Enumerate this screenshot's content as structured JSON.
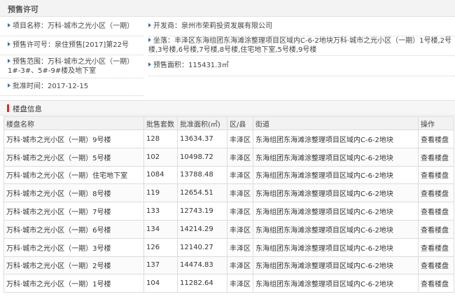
{
  "header": {
    "title": "预售许可"
  },
  "permit": {
    "project_name": "项目名称：万科·城市之光小区（一期）",
    "developer": "开发商：泉州市荣莉投资发展有限公司",
    "permit_no": "预售许可号：泉住预售[2017]第22号",
    "location": "坐落：丰泽区东海组团东海滩涂整理项目区域内C-6-2地块万科·城市之光小区（一期）1号楼,2号楼,3号楼,6号楼,7号楼,8号楼,住宅地下室,5号楼,9号楼",
    "scope": "预售范围：万科·城市之光小区（一期）1#-3#、5#-9#楼及地下室",
    "area": "预售面积：115431.3㎡",
    "approve_time": "批准时间：2017-12-15"
  },
  "section": {
    "title": "楼盘信息"
  },
  "table": {
    "headers": [
      "楼盘名称",
      "批售套数",
      "批准面积(㎡)",
      "区/县",
      "街道",
      "操作"
    ],
    "rows": [
      [
        "万科·城市之光小区（一期）9号楼",
        "128",
        "13634.37",
        "丰泽区",
        "东海组团东海滩涂整理项目区域内C-6-2地块",
        "查看楼盘"
      ],
      [
        "万科·城市之光小区（一期）5号楼",
        "102",
        "10498.72",
        "丰泽区",
        "东海组团东海滩涂整理项目区域内C-6-2地块",
        "查看楼盘"
      ],
      [
        "万科·城市之光小区（一期）住宅地下室",
        "1084",
        "13788.48",
        "丰泽区",
        "东海组团东海滩涂整理项目区域内C-6-2地块",
        "查看楼盘"
      ],
      [
        "万科·城市之光小区（一期）8号楼",
        "119",
        "12654.51",
        "丰泽区",
        "东海组团东海滩涂整理项目区域内C-6-2地块",
        "查看楼盘"
      ],
      [
        "万科·城市之光小区（一期）7号楼",
        "133",
        "12743.19",
        "丰泽区",
        "东海组团东海滩涂整理项目区域内C-6-2地块",
        "查看楼盘"
      ],
      [
        "万科·城市之光小区（一期）6号楼",
        "134",
        "14214.29",
        "丰泽区",
        "东海组团东海滩涂整理项目区域内C-6-2地块",
        "查看楼盘"
      ],
      [
        "万科·城市之光小区（一期）3号楼",
        "126",
        "12140.27",
        "丰泽区",
        "东海组团东海滩涂整理项目区域内C-6-2地块",
        "查看楼盘"
      ],
      [
        "万科·城市之光小区（一期）2号楼",
        "137",
        "14474.83",
        "丰泽区",
        "东海组团东海滩涂整理项目区域内C-6-2地块",
        "查看楼盘"
      ],
      [
        "万科·城市之光小区（一期）1号楼",
        "104",
        "11282.64",
        "丰泽区",
        "东海组团东海滩涂整理项目区域内C-6-2地块",
        "查看楼盘"
      ]
    ]
  }
}
